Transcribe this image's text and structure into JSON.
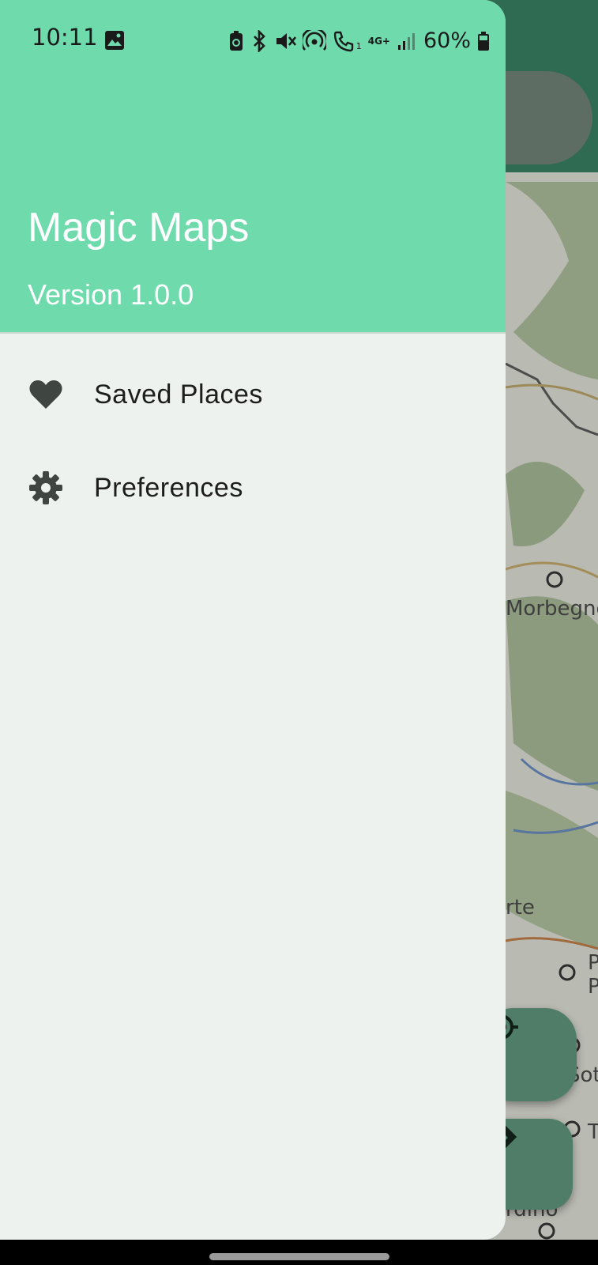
{
  "status_bar": {
    "time": "10:11",
    "network": "4G+",
    "sim_slot": "1",
    "battery": "60%"
  },
  "drawer": {
    "app_name": "Magic Maps",
    "version": "Version 1.0.0",
    "items": [
      {
        "label": "Saved Places",
        "icon": "heart-icon"
      },
      {
        "label": "Preferences",
        "icon": "gear-icon"
      }
    ]
  },
  "map": {
    "labels": [
      "Morbegno",
      "rte",
      "P",
      "P",
      "Sot",
      "T",
      "rdino"
    ]
  },
  "colors": {
    "header": "#6fdbad",
    "drawer_bg": "#edf2ef",
    "topbar": "#2f6a52",
    "fab": "#4f7d68"
  }
}
